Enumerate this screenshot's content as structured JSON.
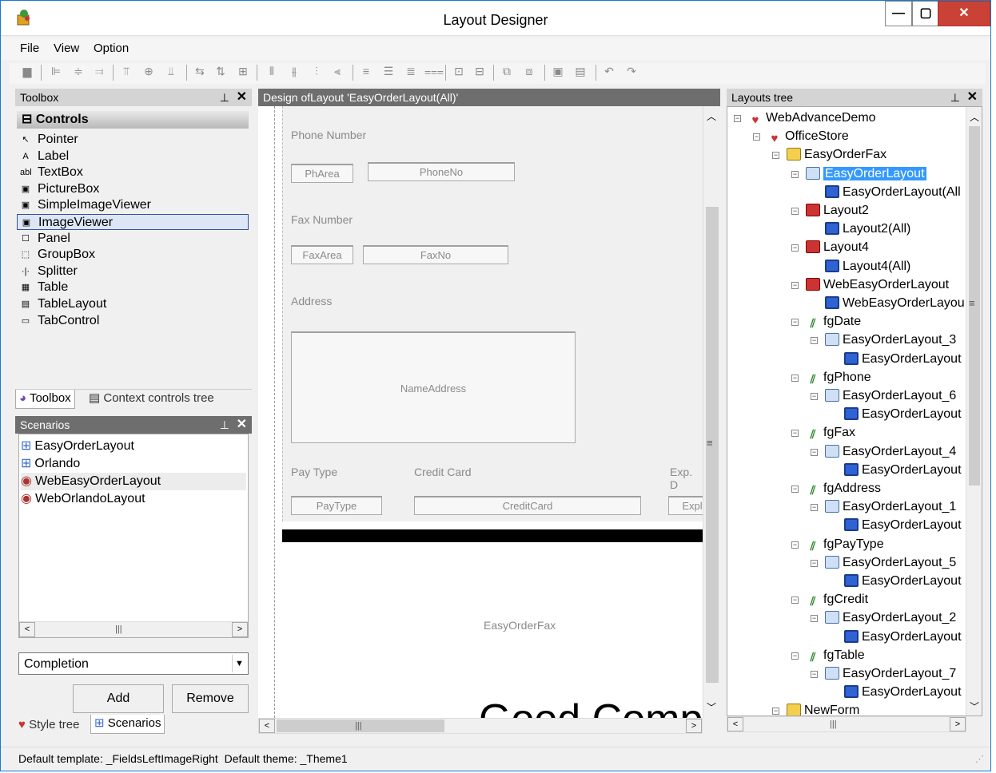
{
  "window": {
    "title": "Layout Designer"
  },
  "menu": [
    "File",
    "View",
    "Option"
  ],
  "toolbox": {
    "header": "Toolbox",
    "group": "Controls",
    "items": [
      {
        "label": "Pointer",
        "icon": "pointer-icon",
        "glyph": "↖"
      },
      {
        "label": "Label",
        "icon": "label-icon",
        "glyph": "A"
      },
      {
        "label": "TextBox",
        "icon": "textbox-icon",
        "glyph": "abl"
      },
      {
        "label": "PictureBox",
        "icon": "picturebox-icon",
        "glyph": "▣"
      },
      {
        "label": "SimpleImageViewer",
        "icon": "simpleimageviewer-icon",
        "glyph": "▣"
      },
      {
        "label": "ImageViewer",
        "icon": "imageviewer-icon",
        "glyph": "▣"
      },
      {
        "label": "Panel",
        "icon": "panel-icon",
        "glyph": "☐"
      },
      {
        "label": "GroupBox",
        "icon": "groupbox-icon",
        "glyph": "⬚"
      },
      {
        "label": "Splitter",
        "icon": "splitter-icon",
        "glyph": "·|·"
      },
      {
        "label": "Table",
        "icon": "table-icon",
        "glyph": "▦"
      },
      {
        "label": "TableLayout",
        "icon": "tablelayout-icon",
        "glyph": "▤"
      },
      {
        "label": "TabControl",
        "icon": "tabcontrol-icon",
        "glyph": "▭"
      }
    ],
    "selected_index": 5,
    "tabs": [
      "Toolbox",
      "Context controls tree"
    ]
  },
  "scenarios": {
    "header": "Scenarios",
    "items": [
      "EasyOrderLayout",
      "Orlando",
      "WebEasyOrderLayout",
      "WebOrlandoLayout"
    ],
    "hover_index": 2,
    "dropdown_value": "Completion",
    "add_label": "Add",
    "remove_label": "Remove",
    "bottom_tabs": [
      "Style tree",
      "Scenarios"
    ]
  },
  "design": {
    "header": "Design ofLayout 'EasyOrderLayout(All)'",
    "labels": {
      "phone": "Phone Number",
      "fax": "Fax Number",
      "address": "Address",
      "paytype": "Pay Type",
      "credit": "Credit Card",
      "exp": "Exp. D"
    },
    "fields": {
      "pharea": "PhArea",
      "phoneno": "PhoneNo",
      "faxarea": "FaxArea",
      "faxno": "FaxNo",
      "nameaddress": "NameAddress",
      "paytype": "PayType",
      "creditcard": "CreditCard",
      "exp": "Expl"
    },
    "image_caption": "EasyOrderFax",
    "big_text": "Good Comp"
  },
  "layouts_tree": {
    "header": "Layouts tree",
    "items": [
      {
        "label": "WebAdvanceDemo",
        "level": 0,
        "icon": "fav"
      },
      {
        "label": "OfficeStore",
        "level": 1,
        "icon": "fav"
      },
      {
        "label": "EasyOrderFax",
        "level": 2,
        "icon": "form"
      },
      {
        "label": "EasyOrderLayout",
        "level": 3,
        "icon": "layout",
        "selected": true
      },
      {
        "label": "EasyOrderLayout(All",
        "level": 4,
        "icon": "win"
      },
      {
        "label": "Layout2",
        "level": 3,
        "icon": "red"
      },
      {
        "label": "Layout2(All)",
        "level": 4,
        "icon": "win"
      },
      {
        "label": "Layout4",
        "level": 3,
        "icon": "red"
      },
      {
        "label": "Layout4(All)",
        "level": 4,
        "icon": "win"
      },
      {
        "label": "WebEasyOrderLayout",
        "level": 3,
        "icon": "red"
      },
      {
        "label": "WebEasyOrderLayou",
        "level": 4,
        "icon": "win"
      },
      {
        "label": "fgDate",
        "level": 3,
        "icon": "fg"
      },
      {
        "label": "EasyOrderLayout_3",
        "level": 4,
        "icon": "layout"
      },
      {
        "label": "EasyOrderLayout",
        "level": 5,
        "icon": "win"
      },
      {
        "label": "fgPhone",
        "level": 3,
        "icon": "fg"
      },
      {
        "label": "EasyOrderLayout_6",
        "level": 4,
        "icon": "layout"
      },
      {
        "label": "EasyOrderLayout",
        "level": 5,
        "icon": "win"
      },
      {
        "label": "fgFax",
        "level": 3,
        "icon": "fg"
      },
      {
        "label": "EasyOrderLayout_4",
        "level": 4,
        "icon": "layout"
      },
      {
        "label": "EasyOrderLayout",
        "level": 5,
        "icon": "win"
      },
      {
        "label": "fgAddress",
        "level": 3,
        "icon": "fg"
      },
      {
        "label": "EasyOrderLayout_1",
        "level": 4,
        "icon": "layout"
      },
      {
        "label": "EasyOrderLayout",
        "level": 5,
        "icon": "win"
      },
      {
        "label": "fgPayType",
        "level": 3,
        "icon": "fg"
      },
      {
        "label": "EasyOrderLayout_5",
        "level": 4,
        "icon": "layout"
      },
      {
        "label": "EasyOrderLayout",
        "level": 5,
        "icon": "win"
      },
      {
        "label": "fgCredit",
        "level": 3,
        "icon": "fg"
      },
      {
        "label": "EasyOrderLayout_2",
        "level": 4,
        "icon": "layout"
      },
      {
        "label": "EasyOrderLayout",
        "level": 5,
        "icon": "win"
      },
      {
        "label": "fgTable",
        "level": 3,
        "icon": "fg"
      },
      {
        "label": "EasyOrderLayout_7",
        "level": 4,
        "icon": "layout"
      },
      {
        "label": "EasyOrderLayout",
        "level": 5,
        "icon": "win"
      },
      {
        "label": "NewForm",
        "level": 2,
        "icon": "form"
      }
    ]
  },
  "statusbar": {
    "text": "Default template: _FieldsLeftImageRight  Default theme: _Theme1"
  }
}
